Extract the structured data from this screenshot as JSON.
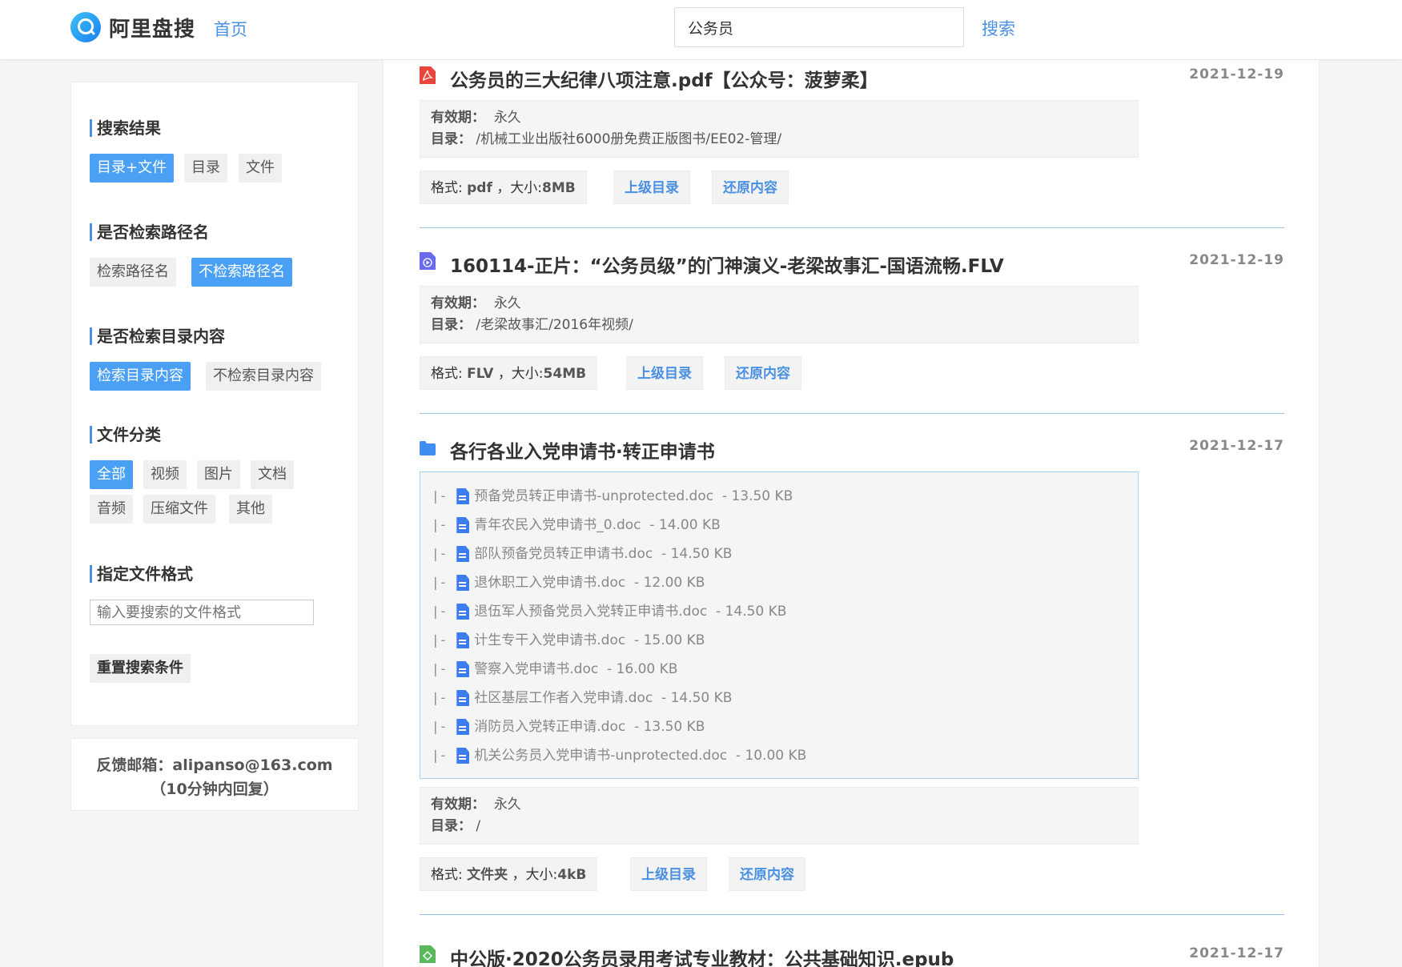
{
  "header": {
    "logo_text": "阿里盘搜",
    "nav_home": "首页",
    "search_value": "公务员",
    "search_button": "搜索"
  },
  "sidebar": {
    "sec_results": "搜索结果",
    "result_tags": [
      "目录+文件",
      "目录",
      "文件"
    ],
    "sec_path": "是否检索路径名",
    "path_tags": [
      "检索路径名",
      "不检索路径名"
    ],
    "sec_dir": "是否检索目录内容",
    "dir_tags": [
      "检索目录内容",
      "不检索目录内容"
    ],
    "sec_category": "文件分类",
    "category_tags": [
      "全部",
      "视频",
      "图片",
      "文档",
      "音频",
      "压缩文件",
      "其他"
    ],
    "sec_format": "指定文件格式",
    "format_placeholder": "输入要搜索的文件格式",
    "reset_button": "重置搜索条件"
  },
  "feedback": {
    "line1": "反馈邮箱：alipanso@163.com",
    "line2": "（10分钟内回复）"
  },
  "labels": {
    "validity": "有效期：",
    "directory": "目录：",
    "format": "格式:",
    "size": "，大小:",
    "parent_dir": "上级目录",
    "restore": "还原内容"
  },
  "results": [
    {
      "icon": "pdf-icon",
      "title": "公务员的三大纪律八项注意.pdf【公众号：菠萝柔】",
      "date": "2021-12-19",
      "validity": "永久",
      "directory": "/机械工业出版社6000册免费正版图书/EE02-管理/",
      "format": "pdf",
      "size": "8MB"
    },
    {
      "icon": "video-icon",
      "title": "160114-正片：“公务员级”的门神演义-老梁故事汇-国语流畅.FLV",
      "date": "2021-12-19",
      "validity": "永久",
      "directory": "/老梁故事汇/2016年视频/",
      "format": "FLV",
      "size": "54MB"
    },
    {
      "icon": "folder-icon",
      "title": "各行各业入党申请书·转正申请书",
      "date": "2021-12-17",
      "files": [
        {
          "name": "预备党员转正申请书-unprotected.doc",
          "size": "13.50 KB"
        },
        {
          "name": "青年农民入党申请书_0.doc",
          "size": "14.00 KB"
        },
        {
          "name": "部队预备党员转正申请书.doc",
          "size": "14.50 KB"
        },
        {
          "name": "退休职工入党申请书.doc",
          "size": "12.00 KB"
        },
        {
          "name": "退伍军人预备党员入党转正申请书.doc",
          "size": "14.50 KB"
        },
        {
          "name": "计生专干入党申请书.doc",
          "size": "15.00 KB"
        },
        {
          "name": "警察入党申请书.doc",
          "size": "16.00 KB"
        },
        {
          "name": "社区基层工作者入党申请.doc",
          "size": "14.50 KB"
        },
        {
          "name": "消防员入党转正申请.doc",
          "size": "13.50 KB"
        },
        {
          "name": "机关公务员入党申请书-unprotected.doc",
          "size": "10.00 KB"
        }
      ],
      "validity": "永久",
      "directory": "/",
      "format": "文件夹",
      "size": "4kB"
    },
    {
      "icon": "epub-icon",
      "title": "中公版·2020公务员录用考试专业教材：公共基础知识.epub",
      "date": "2021-12-17"
    }
  ],
  "colors": {
    "accent": "#4a90e2",
    "active_tag": "#4aa0f5",
    "pdf": "#e8453c",
    "video": "#6a6af0",
    "folder": "#3d8ef0",
    "epub": "#5cb85c"
  }
}
